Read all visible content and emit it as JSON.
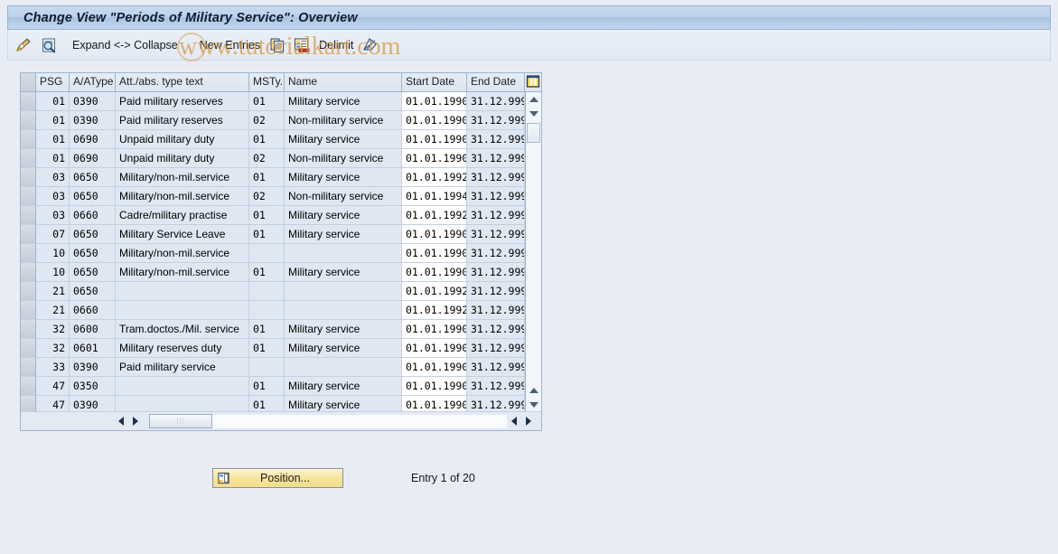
{
  "window": {
    "title": "Change View \"Periods of Military Service\": Overview"
  },
  "watermark": {
    "text": "www.tutorialkart.com",
    "color": "#d79a3e"
  },
  "toolbar": {
    "items": [
      {
        "type": "icon",
        "name": "display-change-icon",
        "label": ""
      },
      {
        "type": "icon",
        "name": "search-document-icon",
        "label": ""
      },
      {
        "type": "button",
        "name": "expand-collapse-button",
        "label": "Expand <-> Collapse"
      },
      {
        "type": "button",
        "name": "new-entries-button",
        "label": "New Entries"
      },
      {
        "type": "icon",
        "name": "copy-icon",
        "label": ""
      },
      {
        "type": "icon",
        "name": "variant-icon",
        "label": ""
      },
      {
        "type": "button",
        "name": "delimit-button",
        "label": "Delimit"
      },
      {
        "type": "icon",
        "name": "undelimit-icon",
        "label": ""
      }
    ],
    "expand_collapse_label": "Expand <-> Collapse",
    "new_entries_label": "New Entries",
    "delimit_label": "Delimit"
  },
  "table": {
    "columns": [
      {
        "key": "psg",
        "label": "PSG"
      },
      {
        "key": "aatype",
        "label": "A/AType"
      },
      {
        "key": "text",
        "label": "Att./abs. type text"
      },
      {
        "key": "msty",
        "label": "MSTy."
      },
      {
        "key": "name",
        "label": "Name"
      },
      {
        "key": "start",
        "label": "Start Date"
      },
      {
        "key": "end",
        "label": "End Date"
      }
    ],
    "config_icon": "table-settings-icon",
    "rows": [
      {
        "psg": "01",
        "aatype": "0390",
        "text": "Paid military reserves",
        "msty": "01",
        "name": "Military service",
        "start": "01.01.1990",
        "end": "31.12.999"
      },
      {
        "psg": "01",
        "aatype": "0390",
        "text": "Paid military reserves",
        "msty": "02",
        "name": "Non-military service",
        "start": "01.01.1990",
        "end": "31.12.999"
      },
      {
        "psg": "01",
        "aatype": "0690",
        "text": "Unpaid military duty",
        "msty": "01",
        "name": "Military service",
        "start": "01.01.1990",
        "end": "31.12.999"
      },
      {
        "psg": "01",
        "aatype": "0690",
        "text": "Unpaid military duty",
        "msty": "02",
        "name": "Non-military service",
        "start": "01.01.1990",
        "end": "31.12.999"
      },
      {
        "psg": "03",
        "aatype": "0650",
        "text": "Military/non-mil.service",
        "msty": "01",
        "name": "Military service",
        "start": "01.01.1992",
        "end": "31.12.999"
      },
      {
        "psg": "03",
        "aatype": "0650",
        "text": "Military/non-mil.service",
        "msty": "02",
        "name": "Non-military service",
        "start": "01.01.1994",
        "end": "31.12.999"
      },
      {
        "psg": "03",
        "aatype": "0660",
        "text": "Cadre/military practise",
        "msty": "01",
        "name": "Military service",
        "start": "01.01.1992",
        "end": "31.12.999"
      },
      {
        "psg": "07",
        "aatype": "0650",
        "text": "Military Service Leave",
        "msty": "01",
        "name": "Military service",
        "start": "01.01.1990",
        "end": "31.12.999"
      },
      {
        "psg": "10",
        "aatype": "0650",
        "text": "Military/non-mil.service",
        "msty": "",
        "name": "",
        "start": "01.01.1990",
        "end": "31.12.999"
      },
      {
        "psg": "10",
        "aatype": "0650",
        "text": "Military/non-mil.service",
        "msty": "01",
        "name": "Military service",
        "start": "01.01.1990",
        "end": "31.12.999"
      },
      {
        "psg": "21",
        "aatype": "0650",
        "text": "",
        "msty": "",
        "name": "",
        "start": "01.01.1992",
        "end": "31.12.999"
      },
      {
        "psg": "21",
        "aatype": "0660",
        "text": "",
        "msty": "",
        "name": "",
        "start": "01.01.1992",
        "end": "31.12.999"
      },
      {
        "psg": "32",
        "aatype": "0600",
        "text": "Tram.doctos./Mil. service",
        "msty": "01",
        "name": "Military service",
        "start": "01.01.1990",
        "end": "31.12.999"
      },
      {
        "psg": "32",
        "aatype": "0601",
        "text": "Military reserves duty",
        "msty": "01",
        "name": "Military service",
        "start": "01.01.1990",
        "end": "31.12.999"
      },
      {
        "psg": "33",
        "aatype": "0390",
        "text": "Paid military service",
        "msty": "",
        "name": "",
        "start": "01.01.1990",
        "end": "31.12.999"
      },
      {
        "psg": "47",
        "aatype": "0350",
        "text": "",
        "msty": "01",
        "name": "Military service",
        "start": "01.01.1990",
        "end": "31.12.999"
      },
      {
        "psg": "47",
        "aatype": "0390",
        "text": "",
        "msty": "01",
        "name": "Military service",
        "start": "01.01.1990",
        "end": "31.12.999"
      }
    ]
  },
  "footer": {
    "position_button_label": "Position...",
    "position_icon": "position-icon",
    "entry_count_label": "Entry 1 of 20"
  }
}
